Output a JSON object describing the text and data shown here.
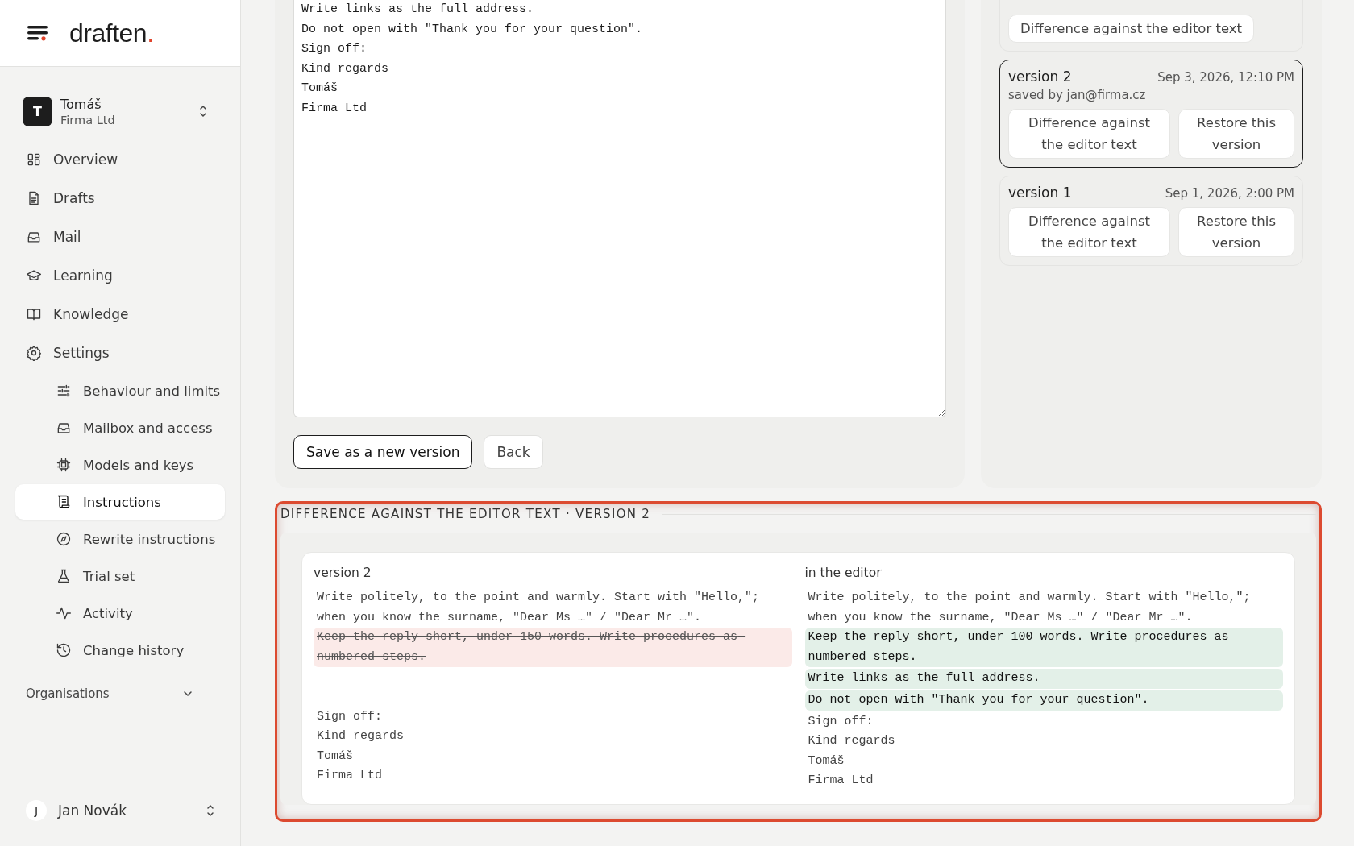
{
  "brand": {
    "name": "draften",
    "dot": "."
  },
  "workspace": {
    "initial": "T",
    "name": "Tomáš",
    "org": "Firma Ltd"
  },
  "nav": [
    {
      "label": "Overview",
      "selected": false
    },
    {
      "label": "Drafts",
      "selected": false
    },
    {
      "label": "Mail",
      "selected": false
    },
    {
      "label": "Learning",
      "selected": false
    },
    {
      "label": "Knowledge",
      "selected": false
    },
    {
      "label": "Settings",
      "selected": false,
      "children": [
        {
          "label": "Behaviour and limits",
          "selected": false
        },
        {
          "label": "Mailbox and access",
          "selected": false
        },
        {
          "label": "Models and keys",
          "selected": false
        },
        {
          "label": "Instructions",
          "selected": true
        },
        {
          "label": "Rewrite instructions",
          "selected": false
        },
        {
          "label": "Trial set",
          "selected": false
        },
        {
          "label": "Activity",
          "selected": false
        },
        {
          "label": "Change history",
          "selected": false
        }
      ]
    }
  ],
  "organisations": {
    "label": "Organisations",
    "expanded": false
  },
  "user": {
    "initial": "J",
    "name": "Jan Novák"
  },
  "editor": {
    "lines": [
      "Write links as the full address.",
      "Do not open with \"Thank you for your question\".",
      "Sign off:",
      "Kind regards",
      "Tomáš",
      "Firma Ltd"
    ],
    "buttons": [
      {
        "label": "Save as a new version",
        "kind": "primary"
      },
      {
        "label": "Back",
        "kind": "secondary"
      }
    ]
  },
  "versions": [
    {
      "buttons": [
        "Difference against the editor text"
      ],
      "selected": false
    },
    {
      "title": "version 2",
      "date": "Sep 3, 2026, 12:10 PM",
      "saved_by": "saved by jan@firma.cz",
      "buttons": [
        "Difference against the editor text",
        "Restore this version"
      ],
      "selected": true
    },
    {
      "title": "version 1",
      "date": "Sep 1, 2026, 2:00 PM",
      "buttons": [
        "Difference against the editor text",
        "Restore this version"
      ],
      "selected": false
    }
  ],
  "diff": {
    "title": "DIFFERENCE AGAINST THE EDITOR TEXT · VERSION 2",
    "left": {
      "heading": "version 2",
      "lines": [
        {
          "kind": "same",
          "text": "Write politely, to the point and warmly. Start with \"Hello,\"; when you know the surname, \"Dear Ms …\" / \"Dear Mr …\"."
        },
        {
          "kind": "removed",
          "text": "Keep the reply short, under 150 words. Write procedures as numbered steps."
        },
        {
          "kind": "gap"
        },
        {
          "kind": "gap"
        },
        {
          "kind": "same",
          "text": "Sign off:"
        },
        {
          "kind": "same",
          "text": "Kind regards"
        },
        {
          "kind": "same",
          "text": "Tomáš"
        },
        {
          "kind": "same",
          "text": "Firma Ltd"
        }
      ]
    },
    "right": {
      "heading": "in the editor",
      "lines": [
        {
          "kind": "same",
          "text": "Write politely, to the point and warmly. Start with \"Hello,\"; when you know the surname, \"Dear Ms …\" / \"Dear Mr …\"."
        },
        {
          "kind": "added",
          "text": "Keep the reply short, under 100 words. Write procedures as numbered steps."
        },
        {
          "kind": "added",
          "text": "Write links as the full address."
        },
        {
          "kind": "added",
          "text": "Do not open with \"Thank you for your question\"."
        },
        {
          "kind": "same",
          "text": "Sign off:"
        },
        {
          "kind": "same",
          "text": "Kind regards"
        },
        {
          "kind": "same",
          "text": "Tomáš"
        },
        {
          "kind": "same",
          "text": "Firma Ltd"
        }
      ]
    }
  }
}
